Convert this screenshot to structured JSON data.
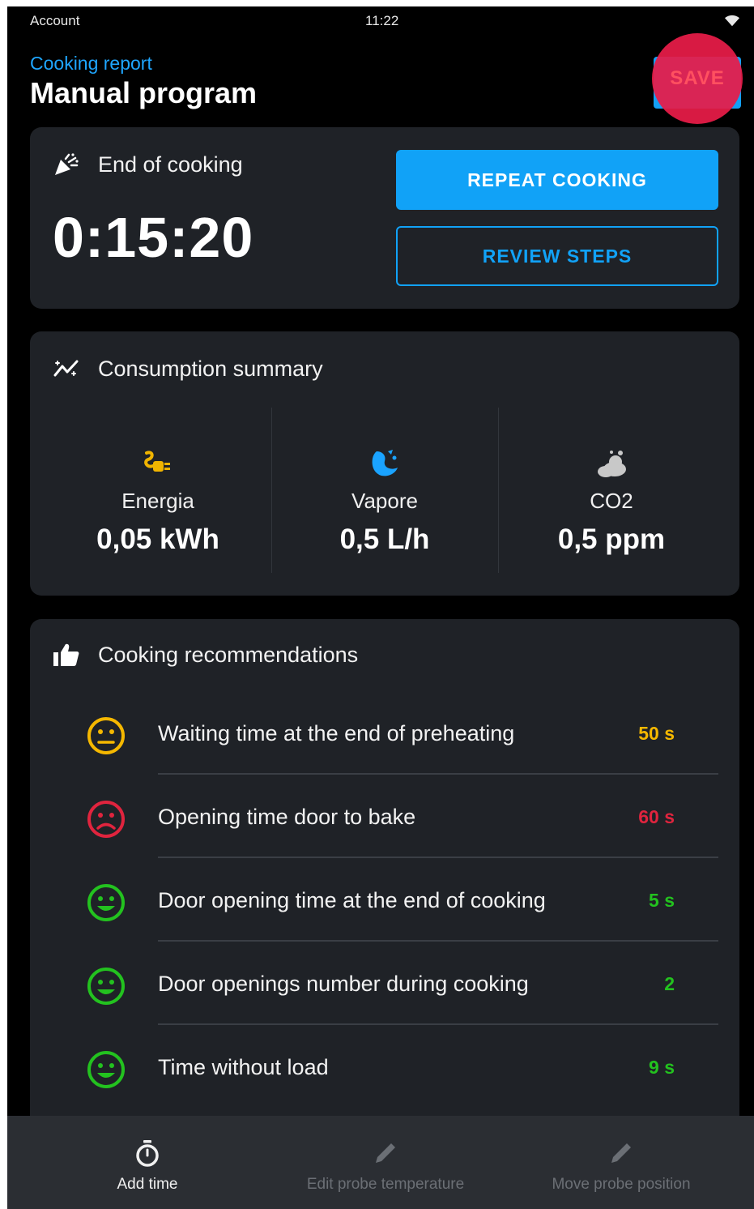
{
  "status_bar": {
    "left_label": "Account",
    "time": "11:22",
    "wifi_icon": "wifi-icon"
  },
  "header": {
    "breadcrumb": "Cooking report",
    "title": "Manual program",
    "save_label": "SAVE"
  },
  "end_card": {
    "label": "End of cooking",
    "icon": "celebration-icon",
    "time": "0:15:20",
    "repeat_label": "REPEAT COOKING",
    "review_label": "REVIEW STEPS"
  },
  "consumption": {
    "title": "Consumption summary",
    "icon": "trend-icon",
    "items": [
      {
        "label": "Energia",
        "value": "0,05 kWh",
        "icon": "power-plug-icon",
        "color": "#f0b400"
      },
      {
        "label": "Vapore",
        "value": "0,5 L/h",
        "icon": "steam-icon",
        "color": "#1aa3ff"
      },
      {
        "label": "CO2",
        "value": "0,5 ppm",
        "icon": "cloud-icon",
        "color": "#c8c8c8"
      }
    ]
  },
  "recommendations": {
    "title": "Cooking recommendations",
    "icon": "thumbs-up-icon",
    "items": [
      {
        "text": "Waiting time at the end of preheating",
        "value": "50 s",
        "face": "neutral",
        "color": "#f5b800"
      },
      {
        "text": "Opening time door to bake",
        "value": "60 s",
        "face": "sad",
        "color": "#e0243e"
      },
      {
        "text": "Door opening time at the end of cooking",
        "value": "5 s",
        "face": "happy",
        "color": "#23c21f"
      },
      {
        "text": "Door openings number during cooking",
        "value": "2",
        "face": "happy",
        "color": "#23c21f"
      },
      {
        "text": "Time without load",
        "value": "9 s",
        "face": "happy",
        "color": "#23c21f"
      }
    ]
  },
  "bottom_bar": {
    "items": [
      {
        "label": "Add time",
        "icon": "stopwatch-icon",
        "enabled": true
      },
      {
        "label": "Edit probe temperature",
        "icon": "pencil-icon",
        "enabled": false
      },
      {
        "label": "Move probe position",
        "icon": "pencil-icon",
        "enabled": false
      }
    ]
  }
}
